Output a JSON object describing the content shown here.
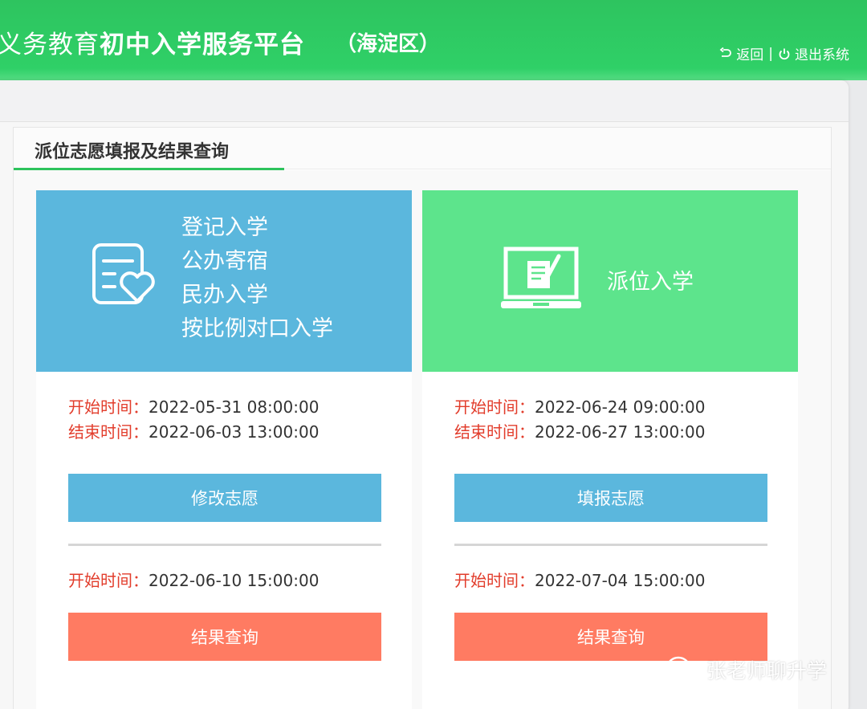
{
  "header": {
    "brand_prefix": "义务教育",
    "title": "初中入学服务平台",
    "district": "（海淀区）",
    "back_label": "返回",
    "separator": "|",
    "logout_label": "退出系统"
  },
  "section": {
    "tab_title": "派位志愿填报及结果查询"
  },
  "cards": [
    {
      "banner_lines": [
        "登记入学",
        "公办寄宿",
        "民办入学",
        "按比例对口入学"
      ],
      "banner_icon": "form-heart-icon",
      "banner_color": "#5bb7dd",
      "start_label": "开始时间：",
      "start_time": "2022-05-31 08:00:00",
      "end_label": "结束时间：",
      "end_time": "2022-06-03 13:00:00",
      "action_label": "修改志愿",
      "result_start_label": "开始时间：",
      "result_start_time": "2022-06-10 15:00:00",
      "result_label": "结果查询"
    },
    {
      "banner_text": "派位入学",
      "banner_icon": "laptop-document-icon",
      "banner_color": "#5de48c",
      "start_label": "开始时间：",
      "start_time": "2022-06-24 09:00:00",
      "end_label": "结束时间：",
      "end_time": "2022-06-27 13:00:00",
      "action_label": "填报志愿",
      "result_start_label": "开始时间：",
      "result_start_time": "2022-07-04 15:00:00",
      "result_label": "结果查询"
    }
  ],
  "watermark": {
    "text": "张老师聊升学",
    "icon": "wechat-icon"
  },
  "colors": {
    "header_green": "#2ec45f",
    "accent_blue": "#5bb7dd",
    "accent_green": "#5de48c",
    "result_orange": "#ff7b62",
    "label_red": "#e23d2c"
  }
}
